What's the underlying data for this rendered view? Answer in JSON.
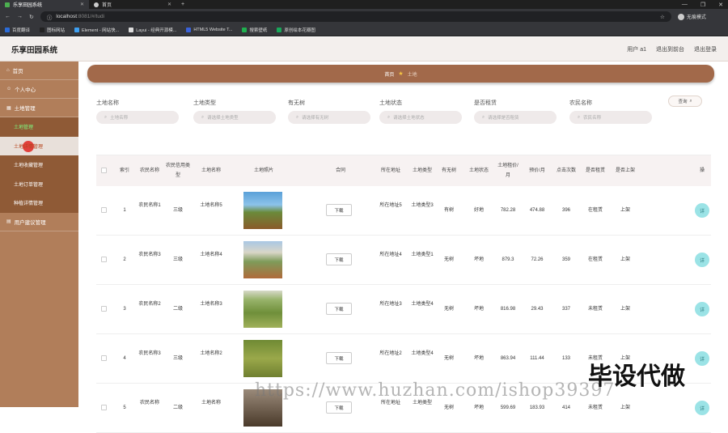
{
  "browser": {
    "tabs": [
      {
        "label": "乐享田园系统",
        "active": true
      },
      {
        "label": "首页",
        "active": false
      }
    ],
    "new_tab": "+",
    "url_host": "localhost",
    "url_rest": ":8081/#/tudi",
    "profile_label": "无痕模式",
    "bookmarks": [
      {
        "label": "百度翻译",
        "color": "#2b6cd8"
      },
      {
        "label": "图标网站",
        "color": "#222222"
      },
      {
        "label": "Element - 网站快...",
        "color": "#3ea0f2"
      },
      {
        "label": "Layui - 经典开源模...",
        "color": "#dddddd"
      },
      {
        "label": "HTML5 Website T...",
        "color": "#3a62d9"
      },
      {
        "label": "搜索壁纸",
        "color": "#1fb04f"
      },
      {
        "label": "原创绘本花瓣图",
        "color": "#18a85a"
      }
    ]
  },
  "header": {
    "title": "乐享田园系统",
    "links": [
      "用户 a1",
      "退出到前台",
      "退出登录"
    ]
  },
  "sidebar": {
    "items": [
      {
        "label": "首页",
        "icon": "home-icon"
      },
      {
        "label": "个人中心",
        "icon": "user-icon"
      },
      {
        "label": "土地管理",
        "icon": "land-icon"
      }
    ],
    "submenu": [
      {
        "label": "土地管理",
        "state": "active"
      },
      {
        "label": "土地详情管理",
        "state": "hover"
      },
      {
        "label": "土地收藏管理",
        "state": ""
      },
      {
        "label": "土地订单管理",
        "state": ""
      },
      {
        "label": "种植详情管理",
        "state": ""
      }
    ],
    "bottom_item": {
      "label": "用户建议管理",
      "icon": "feedback-icon"
    }
  },
  "breadcrumb": {
    "home": "首页",
    "current": "土地"
  },
  "filters": [
    {
      "label": "土地名称",
      "placeholder": "土地名称"
    },
    {
      "label": "土地类型",
      "placeholder": "请选择土地类型"
    },
    {
      "label": "有无树",
      "placeholder": "请选择有无树"
    },
    {
      "label": "土地状态",
      "placeholder": "请选择土地状态"
    },
    {
      "label": "是否租赁",
      "placeholder": "请选择是否租赁"
    },
    {
      "label": "农民名称",
      "placeholder": "农民名称"
    }
  ],
  "search_label": "查询",
  "table": {
    "headers": [
      "索引",
      "农民名称",
      "农民信用类型",
      "土地名称",
      "土地照片",
      "合同",
      "所在地址",
      "土地类型",
      "有无树",
      "土地状态",
      "土地租价/月",
      "预价/月",
      "点击次数",
      "是否租赁",
      "是否上架",
      "操"
    ],
    "download_label": "下载",
    "op_label": "详",
    "rows": [
      {
        "index": "1",
        "farmer": "农民名称1",
        "credit": "三级",
        "land": "土地名称5",
        "address": "所在地址5",
        "type": "土地类型3",
        "tree": "有树",
        "status": "好地",
        "rent": "782.28",
        "price": "474.88",
        "clicks": "396",
        "leased": "在租赁",
        "shelf": "上架",
        "photo": "a"
      },
      {
        "index": "2",
        "farmer": "农民名称3",
        "credit": "三级",
        "land": "土地名称4",
        "address": "所在地址4",
        "type": "土地类型1",
        "tree": "无树",
        "status": "坏地",
        "rent": "879.3",
        "price": "72.26",
        "clicks": "359",
        "leased": "在租赁",
        "shelf": "上架",
        "photo": "b"
      },
      {
        "index": "3",
        "farmer": "农民名称2",
        "credit": "二级",
        "land": "土地名称3",
        "address": "所在地址3",
        "type": "土地类型4",
        "tree": "无树",
        "status": "坏地",
        "rent": "816.98",
        "price": "29.43",
        "clicks": "337",
        "leased": "未租赁",
        "shelf": "上架",
        "photo": "c"
      },
      {
        "index": "4",
        "farmer": "农民名称3",
        "credit": "三级",
        "land": "土地名称2",
        "address": "所在地址2",
        "type": "土地类型4",
        "tree": "无树",
        "status": "坏地",
        "rent": "863.94",
        "price": "111.44",
        "clicks": "133",
        "leased": "未租赁",
        "shelf": "上架",
        "photo": "d"
      },
      {
        "index": "5",
        "farmer": "农民名称",
        "credit": "二级",
        "land": "土地名称",
        "address": "所在地址",
        "type": "土地类型",
        "tree": "无树",
        "status": "坏地",
        "rent": "599.69",
        "price": "183.93",
        "clicks": "414",
        "leased": "未租赁",
        "shelf": "上架",
        "photo": "e"
      }
    ]
  },
  "watermark": "https://www.huzhan.com/ishop39397",
  "overlay_text": "毕设代做"
}
